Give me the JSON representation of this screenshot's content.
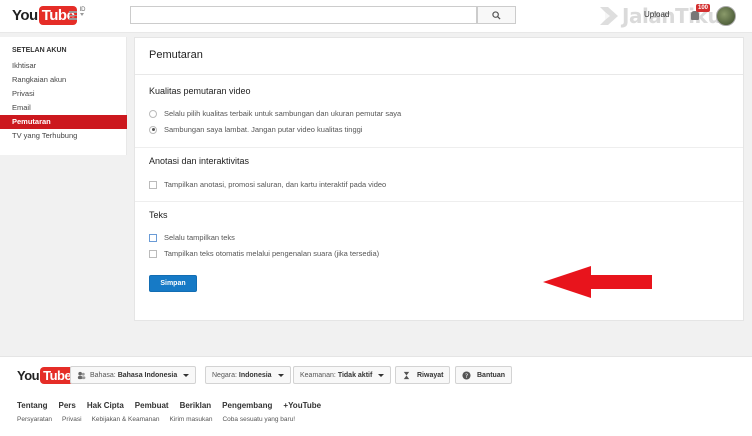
{
  "header": {
    "logo_you": "You",
    "logo_tube": "Tube",
    "logo_region": "ID",
    "search_placeholder": "",
    "upload_label": "Upload",
    "notification_count": "100"
  },
  "watermark": {
    "text": "JalanTikus"
  },
  "sidebar": {
    "heading": "SETELAN AKUN",
    "items": [
      {
        "label": "Ikhtisar",
        "active": false
      },
      {
        "label": "Rangkaian akun",
        "active": false
      },
      {
        "label": "Privasi",
        "active": false
      },
      {
        "label": "Email",
        "active": false
      },
      {
        "label": "Pemutaran",
        "active": true
      },
      {
        "label": "TV yang Terhubung",
        "active": false
      }
    ]
  },
  "main": {
    "title": "Pemutaran",
    "quality": {
      "title": "Kualitas pemutaran video",
      "options": [
        {
          "label": "Selalu pilih kualitas terbaik untuk sambungan dan ukuran pemutar saya",
          "selected": false
        },
        {
          "label": "Sambungan saya lambat. Jangan putar video kualitas tinggi",
          "selected": true
        }
      ]
    },
    "annotations": {
      "title": "Anotasi dan interaktivitas",
      "option": "Tampilkan anotasi, promosi saluran, dan kartu interaktif pada video"
    },
    "captions": {
      "title": "Teks",
      "options": [
        "Selalu tampilkan teks",
        "Tampilkan teks otomatis melalui pengenalan suara (jika tersedia)"
      ]
    },
    "save_label": "Simpan"
  },
  "footer": {
    "language_label": "Bahasa:",
    "language_value": "Bahasa Indonesia",
    "country_label": "Negara:",
    "country_value": "Indonesia",
    "safety_label": "Keamanan:",
    "safety_value": "Tidak aktif",
    "history_label": "Riwayat",
    "help_label": "Bantuan",
    "links_primary": [
      "Tentang",
      "Pers",
      "Hak Cipta",
      "Pembuat",
      "Beriklan",
      "Pengembang",
      "+YouTube"
    ],
    "links_secondary": [
      "Persyaratan",
      "Privasi",
      "Kebijakan & Keamanan",
      "Kirim masukan",
      "Coba sesuatu yang baru!"
    ]
  },
  "colors": {
    "brand_red": "#e52d27",
    "active_red": "#cc181e",
    "save_blue": "#167ac6",
    "arrow_red": "#e8141c"
  }
}
